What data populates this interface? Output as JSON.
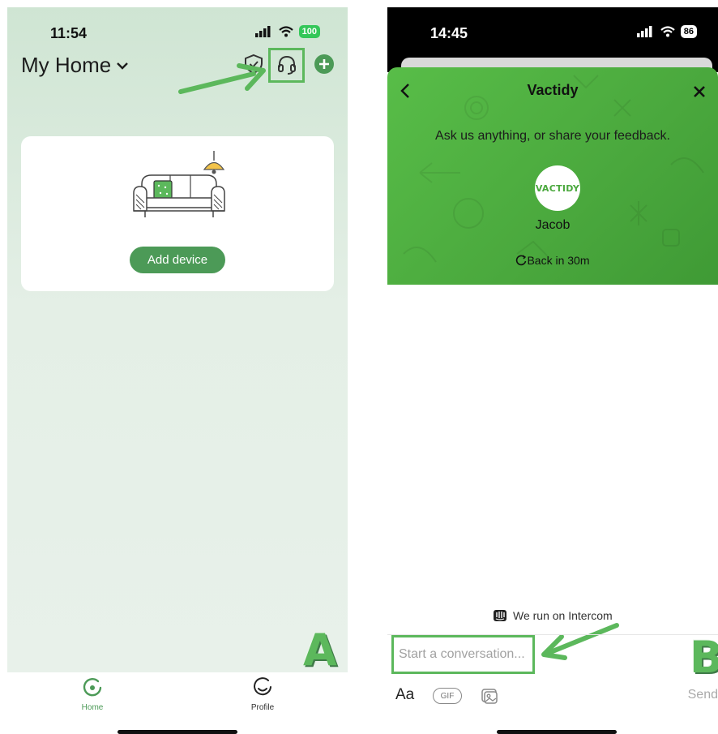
{
  "screen_a": {
    "status": {
      "time": "11:54",
      "battery": "100"
    },
    "header": {
      "title": "My Home"
    },
    "card": {
      "add_device_label": "Add device"
    },
    "annotation_label": "A",
    "tabbar": {
      "home_label": "Home",
      "profile_label": "Profile"
    }
  },
  "screen_b": {
    "status": {
      "time": "14:45",
      "battery": "86"
    },
    "header": {
      "title": "Vactidy",
      "subtitle": "Ask us anything, or share your feedback.",
      "logo_text": "VACTIDY",
      "agent_name": "Jacob",
      "response_time": "Back in 30m"
    },
    "powered_by": "We run on Intercom",
    "composer": {
      "placeholder": "Start a conversation...",
      "format_label": "Aa",
      "gif_label": "GIF",
      "send_label": "Send"
    },
    "annotation_label": "B"
  },
  "colors": {
    "accent_green": "#5cb85c",
    "button_green": "#4c9a57",
    "header_green": "#4fb043"
  }
}
